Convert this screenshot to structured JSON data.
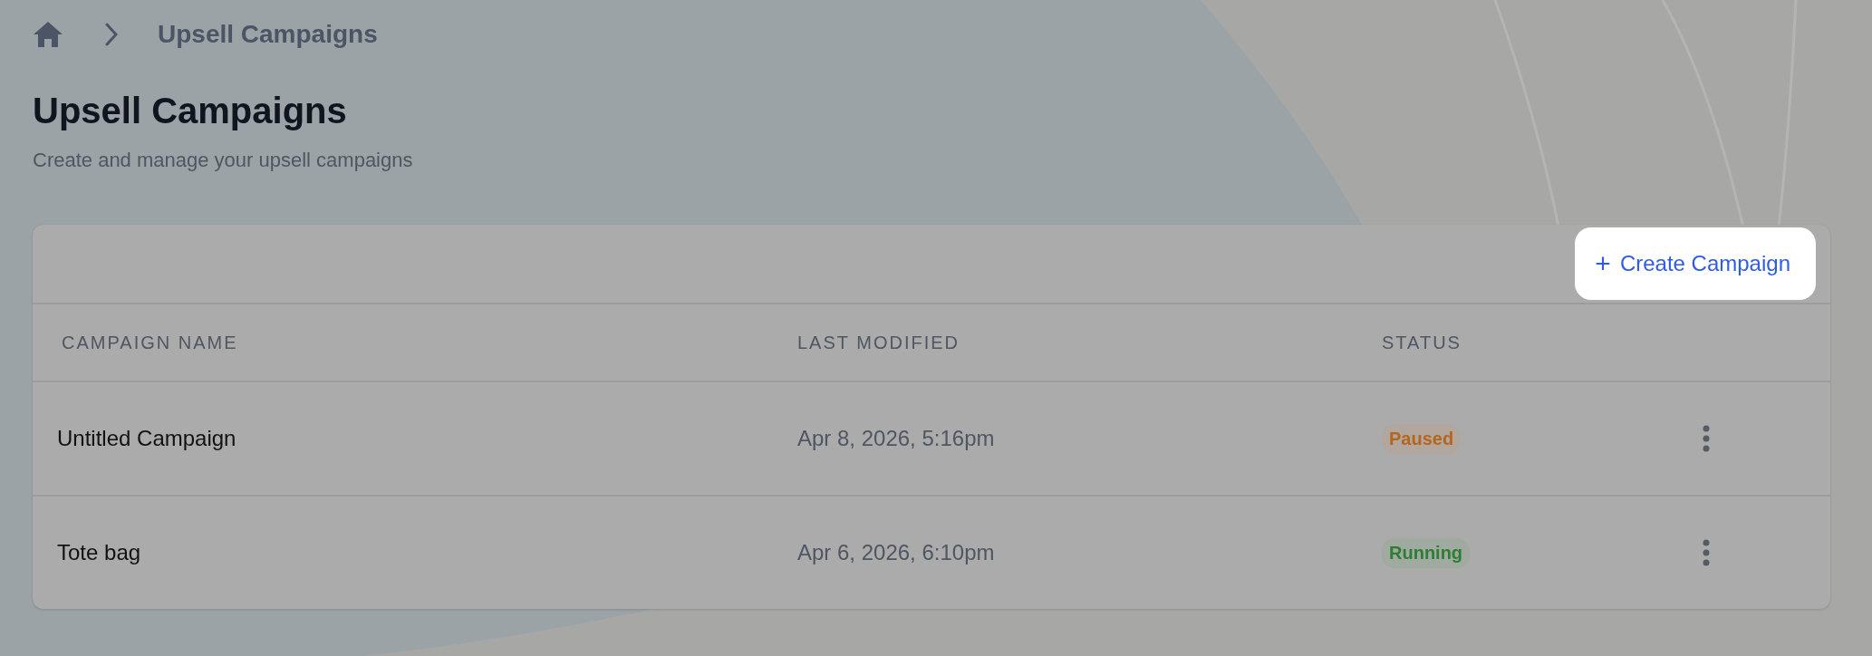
{
  "breadcrumb": {
    "current": "Upsell Campaigns"
  },
  "header": {
    "title": "Upsell Campaigns",
    "subtitle": "Create and manage your upsell campaigns"
  },
  "toolbar": {
    "create_button": {
      "icon": "+",
      "label": "Create Campaign"
    }
  },
  "table": {
    "columns": [
      "CAMPAIGN NAME",
      "LAST MODIFIED",
      "STATUS"
    ],
    "rows": [
      {
        "name": "Untitled Campaign",
        "last_modified": "Apr 8, 2026, 5:16pm",
        "status": {
          "label": "Paused",
          "color": "#b5651d"
        }
      },
      {
        "name": "Tote bag",
        "last_modified": "Apr 6, 2026, 6:10pm",
        "status": {
          "label": "Running",
          "color": "#2e7d32"
        }
      }
    ]
  }
}
